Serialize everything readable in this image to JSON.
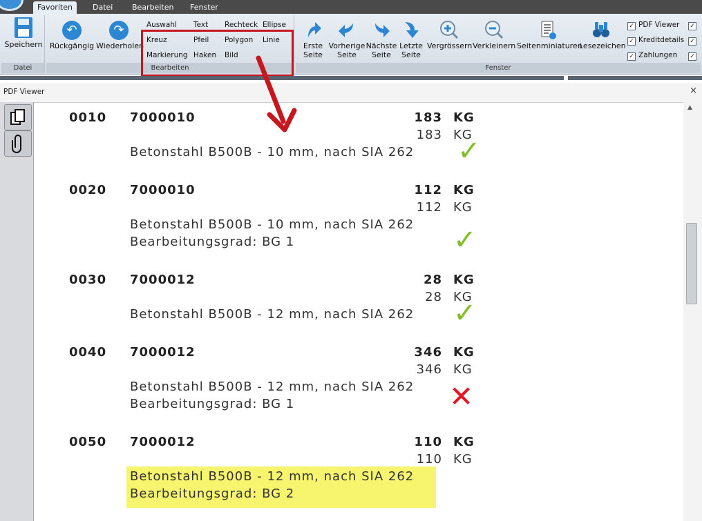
{
  "tabs": {
    "favoriten": "Favoriten",
    "datei": "Datei",
    "bearbeiten": "Bearbeiten",
    "fenster": "Fenster"
  },
  "ribbon": {
    "save_label": "Speichern",
    "undo_label": "Rückgängig",
    "redo_label": "Wiederholen",
    "group_datei": "Datei",
    "group_bearbeiten": "Bearbeiten",
    "group_fenster": "Fenster",
    "tools": {
      "auswahl": "Auswahl",
      "text": "Text",
      "rechteck": "Rechteck",
      "ellipse": "Ellipse",
      "kreuz": "Kreuz",
      "pfeil": "Pfeil",
      "polygon": "Polygon",
      "linie": "Linie",
      "markierung": "Markierung",
      "haken": "Haken",
      "bild": "Bild"
    },
    "nav": {
      "first_1": "Erste",
      "first_2": "Seite",
      "prev_1": "Vorherige",
      "prev_2": "Seite",
      "next_1": "Nächste",
      "next_2": "Seite",
      "last_1": "Letzte",
      "last_2": "Seite",
      "zoom_in": "Vergrössern",
      "zoom_out": "Verkleinern",
      "thumbs": "Seitenminiaturen",
      "bookmarks": "Lesezeichen"
    },
    "checks": {
      "pdf_viewer": "PDF Viewer",
      "kreditdetails": "Kreditdetails",
      "zahlungen": "Zahlungen"
    }
  },
  "panel": {
    "title": "PDF Viewer",
    "close": "×"
  },
  "document": {
    "rows": [
      {
        "pos": "0010",
        "article": "7000010",
        "qty_bold": "183",
        "unit": "KG",
        "qty": "183",
        "desc": "Betonstahl B500B - 10 mm, nach SIA 262",
        "extra": "",
        "status": "ok"
      },
      {
        "pos": "0020",
        "article": "7000010",
        "qty_bold": "112",
        "unit": "KG",
        "qty": "112",
        "desc": "Betonstahl B500B - 10 mm, nach SIA 262",
        "extra": "Bearbeitungsgrad: BG 1",
        "status": "ok"
      },
      {
        "pos": "0030",
        "article": "7000012",
        "qty_bold": "28",
        "unit": "KG",
        "qty": "28",
        "desc": "Betonstahl B500B - 12 mm, nach SIA 262",
        "extra": "",
        "status": "ok"
      },
      {
        "pos": "0040",
        "article": "7000012",
        "qty_bold": "346",
        "unit": "KG",
        "qty": "346",
        "desc": "Betonstahl B500B - 12 mm, nach SIA 262",
        "extra": "Bearbeitungsgrad: BG 1",
        "status": "error"
      },
      {
        "pos": "0050",
        "article": "7000012",
        "qty_bold": "110",
        "unit": "KG",
        "qty": "110",
        "desc": "Betonstahl B500B - 12 mm, nach SIA 262",
        "extra": "Bearbeitungsgrad: BG 2",
        "status": "highlighted"
      }
    ]
  },
  "colors": {
    "accent": "#2c86d1",
    "annotation_red": "#c8161e",
    "check_green": "#7fbf27",
    "highlight": "#f7f56e"
  }
}
